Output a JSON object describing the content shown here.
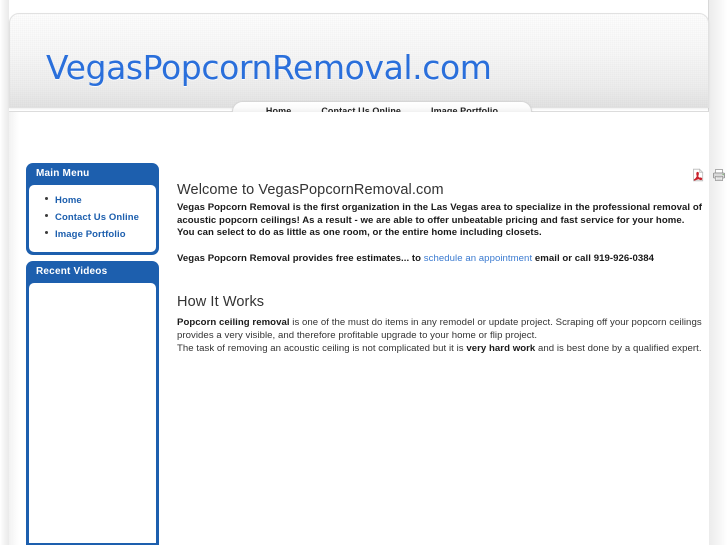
{
  "site": {
    "logo_text": "VegasPopcornRemoval.com",
    "logo_color": "#2a6fdb"
  },
  "nav": {
    "items": [
      {
        "label": "Home"
      },
      {
        "label": "Contact Us Online"
      },
      {
        "label": "Image Portfolio"
      }
    ]
  },
  "sidebar": {
    "main_menu": {
      "title": "Main Menu",
      "items": [
        {
          "label": "Home"
        },
        {
          "label": "Contact Us Online"
        },
        {
          "label": "Image Portfolio"
        }
      ]
    },
    "recent_videos": {
      "title": "Recent Videos"
    }
  },
  "tools": {
    "pdf_label": "pdf-icon",
    "print_label": "print-icon",
    "email_label": "email-icon"
  },
  "main": {
    "welcome_title": "Welcome to VegasPopcornRemoval.com",
    "intro_paragraph": "Vegas Popcorn Removal is the first organization in the Las Vegas area to specialize in the professional removal of acoustic popcorn ceilings!  As a result - we are able to offer unbeatable pricing and fast service for your home.  You can select to do as little as one room, or the entire home including closets.",
    "estimates_before": "Vegas Popcorn Removal provides free estimates... to ",
    "estimates_link": "schedule an appointment",
    "estimates_after": " email or call 919-926-0384",
    "how_it_works_title": "How It Works",
    "hiw_bold_lead": "Popcorn ceiling removal",
    "hiw_line1_rest": " is one of the must do items in any remodel or update project. Scraping off your popcorn ceilings provides a very visible, and therefore profitable upgrade to your home or flip project.",
    "hiw_line2_a": "The task of removing an acoustic ceiling is not complicated but it is ",
    "hiw_line2_bold": "very hard work",
    "hiw_line2_b": " and is best done by a qualified expert."
  },
  "colors": {
    "brand_blue": "#1d5fae",
    "link_blue": "#3a7ad0",
    "logo_blue": "#2a6fdb"
  }
}
